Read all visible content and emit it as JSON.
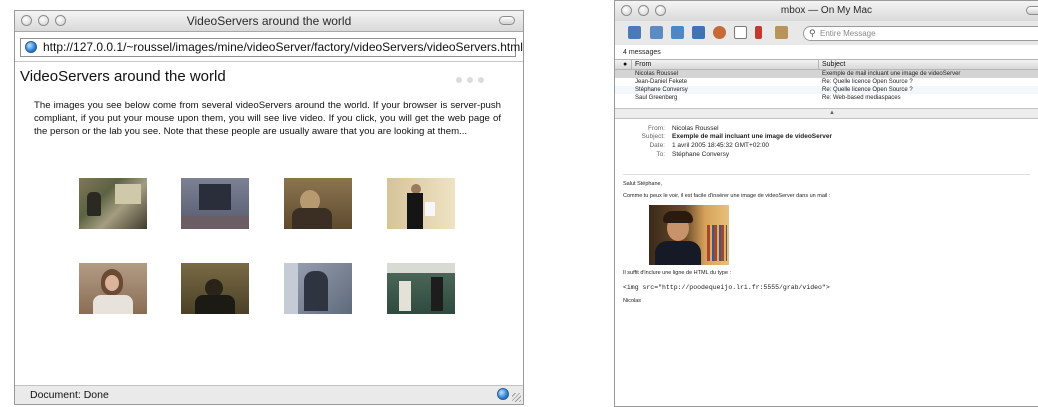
{
  "browser": {
    "title": "VideoServers around the world",
    "url": "http://127.0.0.1/~roussel/images/mine/videoServer/factory/videoServers/videoServers.html",
    "page_title": "VideoServers around the world",
    "intro": "The images you see below come from several videoServers around the world. If your browser is server-push compliant, if you put your mouse upon them, you will see live video. If you click, you will get the web page of the person or the lab you see. Note that these people are usually aware that you are looking at them...",
    "status": "Document: Done"
  },
  "mail": {
    "title": "mbox — On My Mac",
    "search_placeholder": "Entire Message",
    "message_count": "4 messages",
    "columns": {
      "from": "From",
      "subject": "Subject"
    },
    "messages": [
      {
        "from": "Nicolas Roussel",
        "subject": "Exemple de mail incluant une image de videoServer"
      },
      {
        "from": "Jean-Daniel Fekete",
        "subject": "Re: Quelle licence Open Source ?"
      },
      {
        "from": "Stéphane Conversy",
        "subject": "Re: Quelle licence Open Source ?"
      },
      {
        "from": "Saul Greenberg",
        "subject": "Re: Web-based mediaspaces"
      }
    ],
    "header": {
      "from_label": "From:",
      "from": "Nicolas Roussel",
      "subject_label": "Subject:",
      "subject": "Exemple de mail incluant une image de videoServer",
      "date_label": "Date:",
      "date": "1 avril 2005 18:45:32 GMT+02:00",
      "to_label": "To:",
      "to": "Stéphane Conversy"
    },
    "body": {
      "greeting": "Salut Stéphane,",
      "line1": "Comme tu peux le voir, il est facile d'insérer une image de videoServer dans un mail :",
      "line2": "Il suffit d'inclure une ligne de HTML du type :",
      "code": "<img src=\"http://poodequeijo.lri.fr:5555/grab/video\">",
      "signature": "Nicolas"
    }
  },
  "colors": {
    "selection": "#d4d4d4",
    "link_globe": "#2c7fd4"
  }
}
